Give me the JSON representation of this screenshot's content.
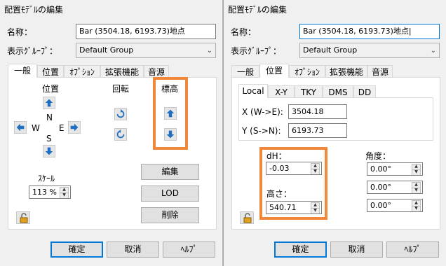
{
  "left": {
    "window_title": "配置ﾓﾃﾞﾙの編集",
    "name_label": "名称：",
    "name_value": "Bar (3504.18, 6193.73)地点",
    "group_label": "表示ｸﾞﾙｰﾌﾟ：",
    "group_value": "Default Group",
    "tabs": [
      "一般",
      "位置",
      "ｵﾌﾟｼｮﾝ",
      "拡張機能",
      "音源"
    ],
    "position_label": "位置",
    "compass": {
      "n": "N",
      "s": "S",
      "e": "E",
      "w": "W"
    },
    "rotation_label": "回転",
    "elevation_label": "標高",
    "scale_label": "ｽｹｰﾙ",
    "scale_value": "113 %",
    "edit_button": "編集",
    "lod_button": "LOD",
    "delete_button": "削除",
    "ok_button": "確定",
    "cancel_button": "取消",
    "help_button": "ﾍﾙﾌﾟ"
  },
  "right": {
    "window_title": "配置ﾓﾃﾞﾙの編集",
    "name_label": "名称：",
    "name_value": "Bar (3504.18, 6193.73)地点",
    "group_label": "表示ｸﾞﾙｰﾌﾟ：",
    "group_value": "Default Group",
    "tabs": [
      "一般",
      "位置",
      "ｵﾌﾟｼｮﾝ",
      "拡張機能",
      "音源"
    ],
    "subtabs": [
      "Local",
      "X-Y",
      "TKY",
      "DMS",
      "DD"
    ],
    "x_label": "X (W->E):",
    "x_value": "3504.18",
    "y_label": "Y (S->N):",
    "y_value": "6193.73",
    "dh_label": "dH：",
    "dh_value": "-0.03",
    "height_label": "高さ：",
    "height_value": "540.71",
    "angle_label": "角度：",
    "angles": [
      "0.00°",
      "0.00°",
      "0.00°"
    ],
    "ok_button": "確定",
    "cancel_button": "取消",
    "help_button": "ﾍﾙﾌﾟ"
  },
  "colors": {
    "highlight": "#f0883c",
    "focus": "#0078d7",
    "arrow": "#1e6fc2"
  }
}
